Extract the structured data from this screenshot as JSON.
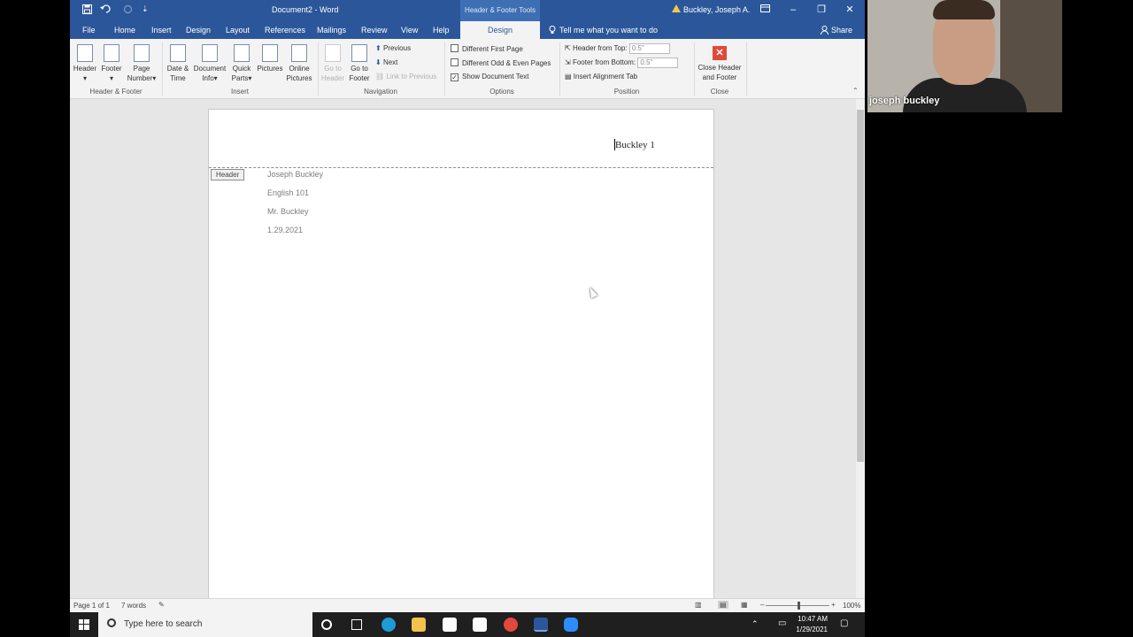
{
  "titlebar": {
    "doc_title": "Document2 - Word",
    "context_tab_group": "Header & Footer Tools",
    "user": "Buckley, Joseph A."
  },
  "tabs": [
    "File",
    "Home",
    "Insert",
    "Design",
    "Layout",
    "References",
    "Mailings",
    "Review",
    "View",
    "Help"
  ],
  "active_context_tab": "Design",
  "tell_me": "Tell me what you want to do",
  "share": "Share",
  "ribbon": {
    "header_label": "Header",
    "footer_label": "Footer",
    "page_number_line1": "Page",
    "page_number_line2": "Number",
    "group_header_footer": "Header & Footer",
    "date_time_line1": "Date &",
    "date_time_line2": "Time",
    "doc_info_line1": "Document",
    "doc_info_line2": "Info",
    "quick_parts_line1": "Quick",
    "quick_parts_line2": "Parts",
    "pictures": "Pictures",
    "online_pictures_line1": "Online",
    "online_pictures_line2": "Pictures",
    "group_insert": "Insert",
    "goto_header_line1": "Go to",
    "goto_header_line2": "Header",
    "goto_footer_line1": "Go to",
    "goto_footer_line2": "Footer",
    "previous": "Previous",
    "next": "Next",
    "link_to_previous": "Link to Previous",
    "group_navigation": "Navigation",
    "different_first_page": "Different First Page",
    "different_odd_even": "Different Odd & Even Pages",
    "show_document_text": "Show Document Text",
    "group_options": "Options",
    "header_from_top": "Header from Top:",
    "header_from_top_value": "0.5\"",
    "footer_from_bottom": "Footer from Bottom:",
    "footer_from_bottom_value": "0.5\"",
    "insert_alignment_tab": "Insert Alignment Tab",
    "group_position": "Position",
    "close_line1": "Close Header",
    "close_line2": "and Footer",
    "group_close": "Close"
  },
  "options_checked": {
    "different_first_page": false,
    "different_odd_even": false,
    "show_document_text": true
  },
  "document": {
    "header_text": "Buckley 1",
    "header_tag": "Header",
    "lines": [
      "Joseph Buckley",
      "English 101",
      "Mr. Buckley",
      "1.29.2021"
    ]
  },
  "status": {
    "page": "Page 1 of 1",
    "words": "7 words",
    "zoom": "100%"
  },
  "webcam": {
    "name": "joseph buckley"
  },
  "taskbar": {
    "search_placeholder": "Type here to search",
    "time": "10:47 AM",
    "date": "1/29/2021"
  },
  "colors": {
    "word_blue": "#2b579a",
    "close_red": "#e04a3a"
  }
}
